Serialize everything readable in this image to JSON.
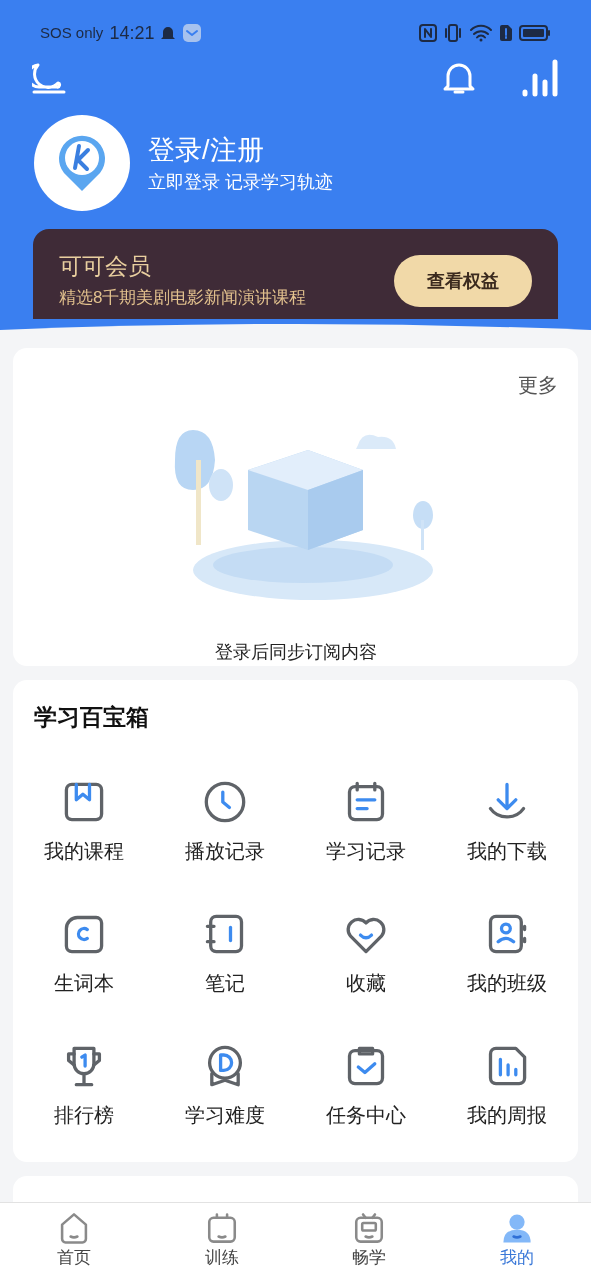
{
  "status_bar": {
    "carrier": "SOS only",
    "time": "14:21"
  },
  "header": {
    "title": "登录/注册",
    "subtitle": "立即登录 记录学习轨迹"
  },
  "membership": {
    "title": "可可会员",
    "description": "精选8千期美剧电影新闻演讲课程",
    "button": "查看权益"
  },
  "subscriptions": {
    "more": "更多",
    "empty_text": "登录后同步订阅内容"
  },
  "toolbox": {
    "title": "学习百宝箱",
    "items": [
      {
        "kind": "course",
        "label": "我的课程"
      },
      {
        "kind": "history",
        "label": "播放记录"
      },
      {
        "kind": "record",
        "label": "学习记录"
      },
      {
        "kind": "download",
        "label": "我的下载"
      },
      {
        "kind": "vocab",
        "label": "生词本"
      },
      {
        "kind": "notes",
        "label": "笔记"
      },
      {
        "kind": "favorite",
        "label": "收藏"
      },
      {
        "kind": "class",
        "label": "我的班级"
      },
      {
        "kind": "ranking",
        "label": "排行榜"
      },
      {
        "kind": "difficulty",
        "label": "学习难度"
      },
      {
        "kind": "tasks",
        "label": "任务中心"
      },
      {
        "kind": "report",
        "label": "我的周报"
      }
    ]
  },
  "tab_bar": [
    {
      "kind": "home",
      "label": "首页",
      "selected": false
    },
    {
      "kind": "training",
      "label": "训练",
      "selected": false
    },
    {
      "kind": "learn",
      "label": "畅学",
      "selected": false
    },
    {
      "kind": "me",
      "label": "我的",
      "selected": true
    }
  ]
}
